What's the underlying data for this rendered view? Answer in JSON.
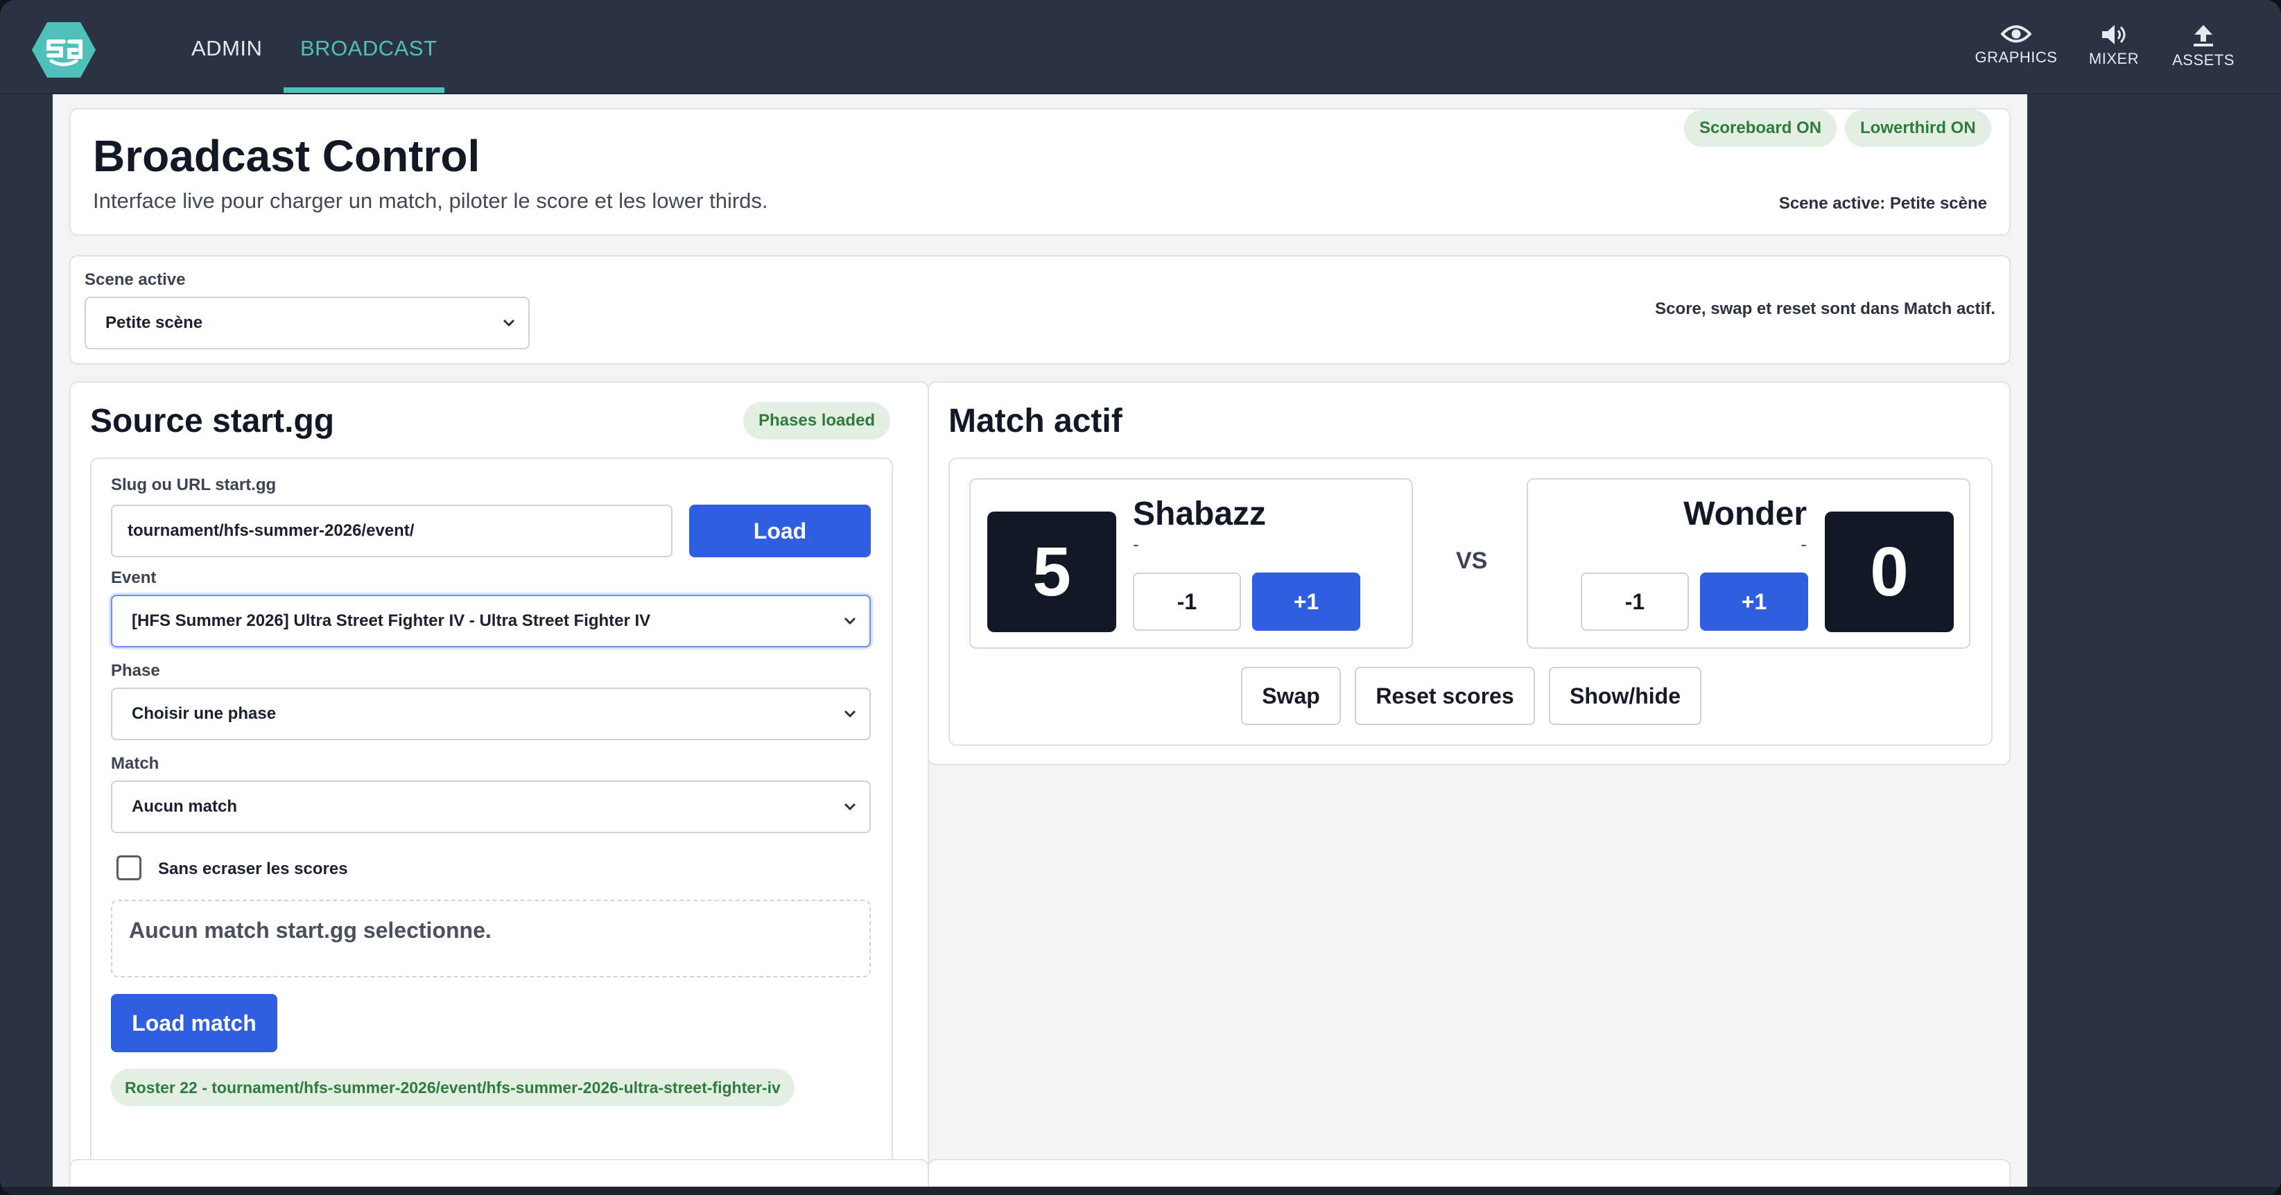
{
  "nav": {
    "admin": "ADMIN",
    "broadcast": "BROADCAST",
    "tools": [
      {
        "label": "GRAPHICS",
        "icon": "eye-icon"
      },
      {
        "label": "MIXER",
        "icon": "speaker-icon"
      },
      {
        "label": "ASSETS",
        "icon": "upload-icon"
      }
    ]
  },
  "header": {
    "title": "Broadcast Control",
    "subtitle": "Interface live pour charger un match, piloter le score et les lower thirds.",
    "badges": [
      "Scoreboard ON",
      "Lowerthird ON"
    ],
    "scene_status": "Scene active: Petite scène"
  },
  "scene": {
    "label": "Scene active",
    "selected": "Petite scène",
    "note": "Score, swap et reset sont dans Match actif."
  },
  "source": {
    "title": "Source start.gg",
    "badge": "Phases loaded",
    "slug_label": "Slug ou URL start.gg",
    "slug_value": "tournament/hfs-summer-2026/event/",
    "load_label": "Load",
    "event_label": "Event",
    "event_selected": "[HFS Summer 2026] Ultra Street Fighter IV - Ultra Street Fighter IV",
    "phase_label": "Phase",
    "phase_selected": "Choisir une phase",
    "match_label": "Match",
    "match_selected": "Aucun match",
    "checkbox_label": "Sans ecraser les scores",
    "empty_message": "Aucun match start.gg selectionne.",
    "load_match_label": "Load match",
    "roster": "Roster 22 - tournament/hfs-summer-2026/event/hfs-summer-2026-ultra-street-fighter-iv"
  },
  "match": {
    "title": "Match actif",
    "vs": "VS",
    "player1": {
      "name": "Shabazz",
      "tag": "-",
      "score": "5",
      "minus": "-1",
      "plus": "+1"
    },
    "player2": {
      "name": "Wonder",
      "tag": "-",
      "score": "0",
      "minus": "-1",
      "plus": "+1"
    },
    "actions": {
      "swap": "Swap",
      "reset": "Reset scores",
      "showhide": "Show/hide"
    }
  },
  "colors": {
    "accent": "#4fc1ba",
    "primary_button": "#2f5fe0",
    "badge_bg": "#e3efe3",
    "badge_text": "#2f7a3d",
    "score_bg": "#121826"
  }
}
